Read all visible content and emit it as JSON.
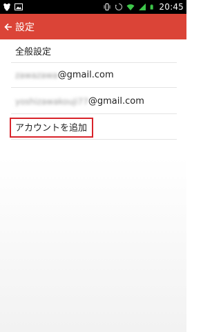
{
  "status_bar": {
    "clock": "20:45"
  },
  "app_bar": {
    "title": "設定",
    "back_icon": "arrow-left-icon"
  },
  "list": {
    "general_settings": "全般設定",
    "accounts": [
      {
        "masked_name": "zawazawa",
        "domain": "@gmail.com"
      },
      {
        "masked_name": "yoshizawakouji77",
        "domain": "@gmail.com"
      }
    ],
    "add_account": "アカウントを追加"
  },
  "colors": {
    "app_bar": "#db4437",
    "highlight": "#d8232a",
    "status_bar": "#000000"
  }
}
